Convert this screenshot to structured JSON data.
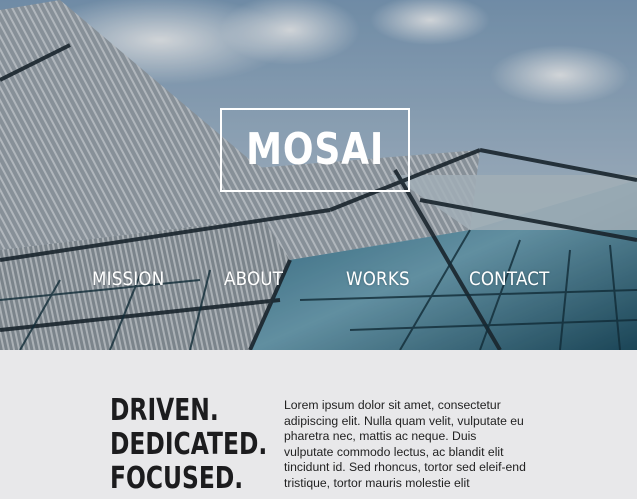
{
  "brand": {
    "logo_text": "MOSAI"
  },
  "nav": {
    "items": [
      {
        "label": "MISSION"
      },
      {
        "label": "ABOUT"
      },
      {
        "label": "WORKS"
      },
      {
        "label": "CONTACT"
      }
    ]
  },
  "intro": {
    "tagline_lines": [
      "DRIVEN.",
      "DEDICATED.",
      "FOCUSED."
    ],
    "body": "Lorem ipsum dolor sit amet, consectetur adipiscing elit. Nulla quam velit, vulputate eu pharetra nec, mattis ac neque. Duis vulputate commodo lectus, ac blandit elit tincidunt id. Sed rhoncus, tortor sed eleif-end tristique, tortor mauris molestie elit"
  },
  "colors": {
    "content_background": "#e8e8ea",
    "heading_text": "#1c1c1e",
    "hero_overlay_text": "#ffffff"
  }
}
